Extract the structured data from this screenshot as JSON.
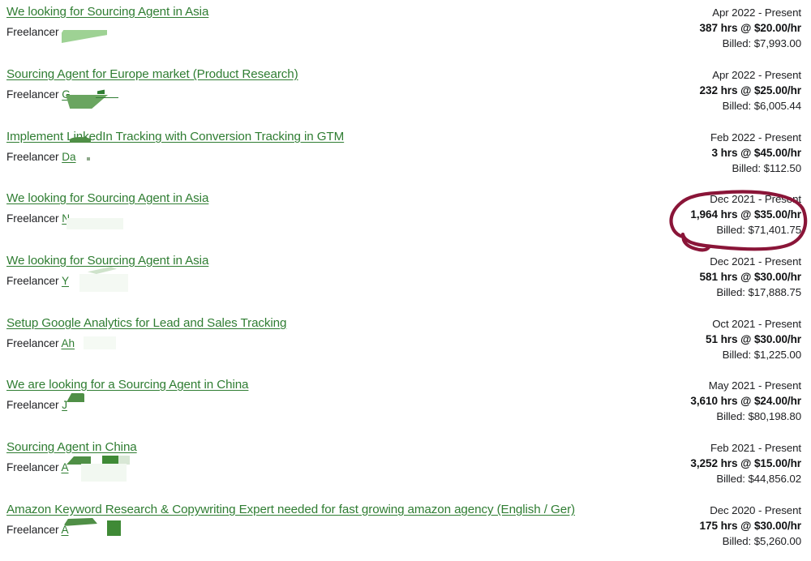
{
  "page": {
    "freelancer_label": "Freelancer",
    "link_color": "#2f7d32",
    "text_color": "#202124",
    "annotation_color": "#8a1538"
  },
  "annotation": {
    "shape": "hand-drawn-circle-with-tail",
    "target_row_index": 3,
    "color": "#8a1538"
  },
  "rows": [
    {
      "title": "We looking for Sourcing Agent in Asia",
      "freelancer_initial": "",
      "period": "Apr 2022 - Present",
      "rate": "387 hrs @ $20.00/hr",
      "billed": "Billed: $7,993.00"
    },
    {
      "title": "Sourcing Agent for Europe market (Product Research)",
      "freelancer_initial": "G",
      "period": "Apr 2022 - Present",
      "rate": "232 hrs @ $25.00/hr",
      "billed": "Billed: $6,005.44"
    },
    {
      "title": "Implement LinkedIn Tracking with Conversion Tracking in GTM",
      "freelancer_initial": "Da",
      "period": "Feb 2022 - Present",
      "rate": "3 hrs @ $45.00/hr",
      "billed": "Billed: $112.50"
    },
    {
      "title": "We looking for Sourcing Agent in Asia",
      "freelancer_initial": "N",
      "period": "Dec 2021 - Present",
      "rate": "1,964 hrs @ $35.00/hr",
      "billed": "Billed: $71,401.75"
    },
    {
      "title": "We looking for Sourcing Agent in Asia",
      "freelancer_initial": "Y",
      "period": "Dec 2021 - Present",
      "rate": "581 hrs @ $30.00/hr",
      "billed": "Billed: $17,888.75"
    },
    {
      "title": "Setup Google Analytics for Lead and Sales Tracking",
      "freelancer_initial": "Ah",
      "period": "Oct 2021 - Present",
      "rate": "51 hrs @ $30.00/hr",
      "billed": "Billed: $1,225.00"
    },
    {
      "title": "We are looking for a Sourcing Agent in China",
      "freelancer_initial": "J",
      "period": "May 2021 - Present",
      "rate": "3,610 hrs @ $24.00/hr",
      "billed": "Billed: $80,198.80"
    },
    {
      "title": "Sourcing Agent in China",
      "freelancer_initial": "A",
      "period": "Feb 2021 - Present",
      "rate": "3,252 hrs @ $15.00/hr",
      "billed": "Billed: $44,856.02"
    },
    {
      "title": "Amazon Keyword Research & Copywriting Expert needed for fast growing amazon agency (English / Ger)",
      "freelancer_initial": "A",
      "period": "Dec 2020 - Present",
      "rate": "175 hrs @ $30.00/hr",
      "billed": "Billed: $5,260.00"
    }
  ]
}
